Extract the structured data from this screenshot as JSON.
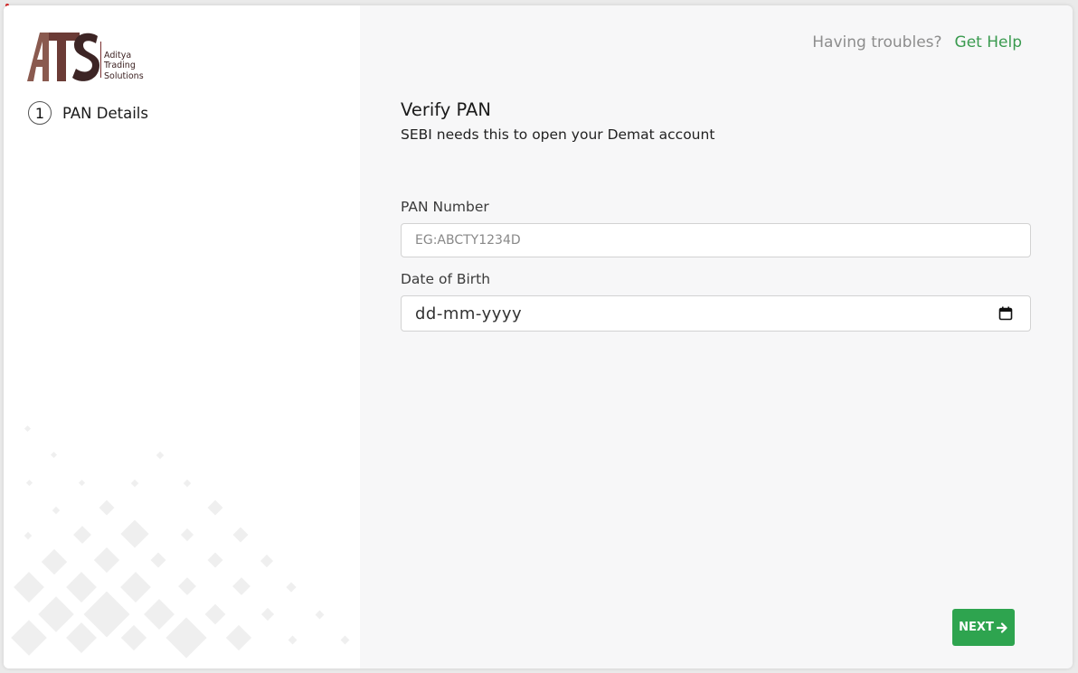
{
  "brand": {
    "logo_letters": "ATS",
    "name_line1": "Aditya",
    "name_line2": "Trading",
    "name_line3": "Solutions"
  },
  "steps": [
    {
      "number": "1",
      "label": "PAN Details"
    }
  ],
  "help": {
    "text": "Having troubles?",
    "link": "Get Help"
  },
  "form": {
    "title": "Verify PAN",
    "subtitle": "SEBI needs this to open your Demat account",
    "pan": {
      "label": "PAN Number",
      "placeholder": "EG:ABCTY1234D"
    },
    "dob": {
      "label": "Date of Birth",
      "value": "dd-mm-yyyy"
    }
  },
  "next_button": "NEXT",
  "colors": {
    "accent_green": "#2ea44f",
    "link_green": "#3a9a4f",
    "brand_brown": "#7a2f2f"
  }
}
